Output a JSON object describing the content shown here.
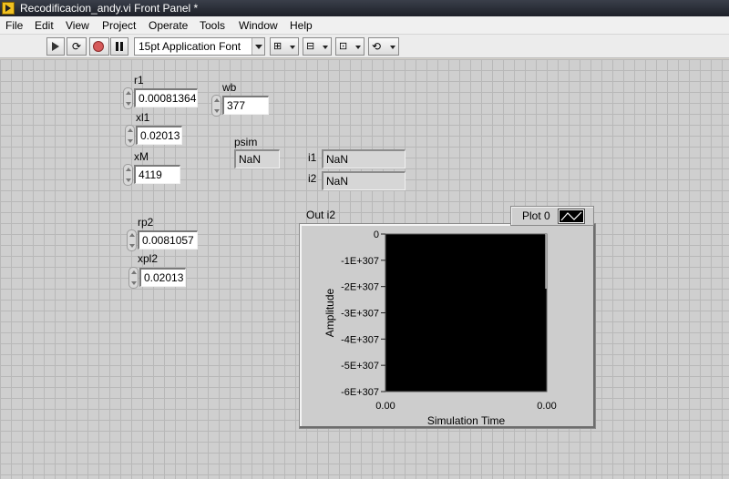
{
  "window": {
    "title": "Recodificacion_andy.vi Front Panel *"
  },
  "menu": [
    "File",
    "Edit",
    "View",
    "Project",
    "Operate",
    "Tools",
    "Window",
    "Help"
  ],
  "toolbar": {
    "font_label": "15pt Application Font"
  },
  "controls": {
    "r1": {
      "label": "r1",
      "value": "0.00081364"
    },
    "xl1": {
      "label": "xl1",
      "value": "0.02013"
    },
    "xM": {
      "label": "xM",
      "value": "4119"
    },
    "wb": {
      "label": "wb",
      "value": "377"
    },
    "rp2": {
      "label": "rp2",
      "value": "0.0081057"
    },
    "xpl2": {
      "label": "xpl2",
      "value": "0.02013"
    }
  },
  "indicators": {
    "psim": {
      "label": "psim",
      "value": "NaN"
    },
    "i1": {
      "label": "i1",
      "value": "NaN"
    },
    "i2": {
      "label": "i2",
      "value": "NaN"
    }
  },
  "graph": {
    "title": "Out  i2",
    "legend": "Plot 0",
    "xlabel": "Simulation Time",
    "ylabel": "Amplitude",
    "plot_bg": "#000000"
  },
  "chart_data": {
    "type": "line",
    "title": "Out  i2",
    "xlabel": "Simulation Time",
    "ylabel": "Amplitude",
    "x_tick_labels": [
      "0.00",
      "0.00"
    ],
    "y_tick_labels": [
      "0",
      "-1E+307",
      "-2E+307",
      "-3E+307",
      "-4E+307",
      "-5E+307",
      "-6E+307"
    ],
    "ylim": [
      -6e+307,
      0
    ],
    "series": [
      {
        "name": "Plot 0",
        "values": []
      }
    ],
    "grid": false,
    "legend_position": "top-right"
  }
}
